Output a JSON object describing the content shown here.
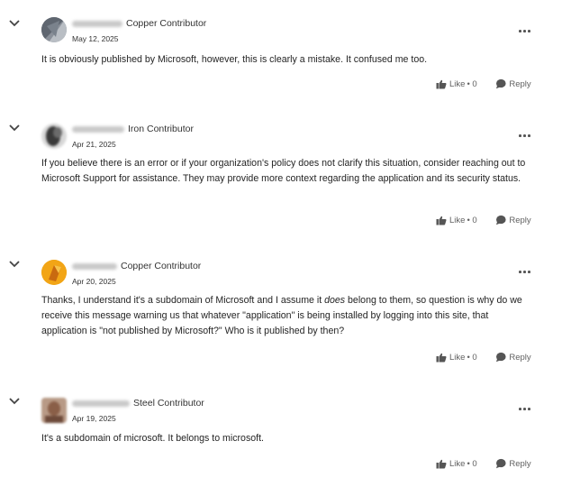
{
  "comments": [
    {
      "author_blurred": "Mieke_Cristel",
      "rank": "Copper Contributor",
      "date": "May 12, 2025",
      "body": "It is obviously published by Microsoft, however, this is clearly a mistake. It confused me too.",
      "like_label": "Like",
      "like_count": "• 0",
      "reply_label": "Reply",
      "avatar": "geometric-grey",
      "expanded": true
    },
    {
      "author_blurred": "BarnettFrost",
      "rank": "Iron Contributor",
      "date": "Apr 21, 2025",
      "body": "If you believe there is an error or if your organization's policy does not clarify this situation, consider reaching out to Microsoft Support for assistance. They may provide more context regarding the application and its security status.",
      "like_label": "Like",
      "like_count": "• 0",
      "reply_label": "Reply",
      "avatar": "photo-dark",
      "expanded": true
    },
    {
      "author_blurred": "mason499",
      "rank": "Copper Contributor",
      "date": "Apr 20, 2025",
      "body_parts": [
        "Thanks, I understand it's a subdomain of Microsoft and I assume it ",
        "does",
        " belong to them, so question is why do we receive this message warning us that whatever \"application\" is being installed by logging into this site, that application is \"not published by Microsoft?\" Who is it published by then?"
      ],
      "like_label": "Like",
      "like_count": "• 0",
      "reply_label": "Reply",
      "avatar": "orange-logo",
      "expanded": true
    },
    {
      "author_blurred": "Robin_Baynes",
      "rank": "Steel Contributor",
      "date": "Apr 19, 2025",
      "body": "It's a subdomain of microsoft. It belongs to microsoft.",
      "like_label": "Like",
      "like_count": "• 0",
      "reply_label": "Reply",
      "avatar": "photo-brown",
      "expanded": true
    }
  ],
  "colors": {
    "text": "#242424",
    "meta": "#616161",
    "icon": "#555555"
  },
  "icons": [
    "chevron-down-icon",
    "more-options-icon",
    "thumbs-up-icon",
    "reply-bubble-icon"
  ]
}
